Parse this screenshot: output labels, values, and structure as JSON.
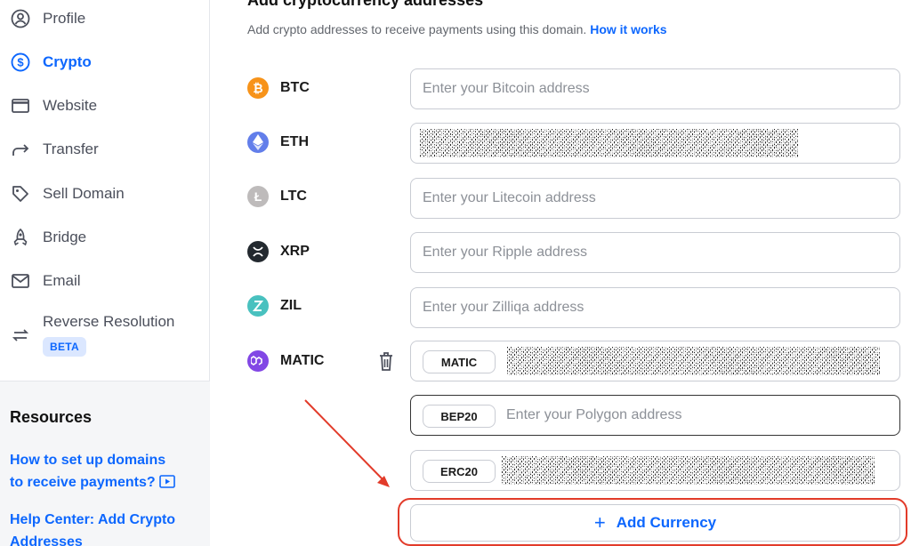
{
  "sidebar": {
    "items": [
      {
        "label": "Profile",
        "icon": "profile-icon"
      },
      {
        "label": "Crypto",
        "icon": "dollar-circle-icon",
        "active": true
      },
      {
        "label": "Website",
        "icon": "browser-window-icon"
      },
      {
        "label": "Transfer",
        "icon": "forward-arrow-icon"
      },
      {
        "label": "Sell Domain",
        "icon": "tag-icon"
      },
      {
        "label": "Bridge",
        "icon": "rocket-icon"
      },
      {
        "label": "Email",
        "icon": "mail-icon"
      },
      {
        "label": "Reverse Resolution",
        "icon": "swap-arrows-icon",
        "badge": "BETA"
      }
    ],
    "resources": {
      "title": "Resources",
      "links": [
        {
          "line1": "How to set up domains",
          "line2": "to receive payments?"
        },
        {
          "line1": "Help Center: Add Crypto",
          "line2": "Addresses"
        }
      ]
    }
  },
  "main": {
    "heading": "Add cryptocurrency addresses",
    "subtitle": "Add crypto addresses to receive payments using this domain.",
    "how_link": "How it works",
    "currencies": [
      {
        "symbol": "BTC",
        "placeholder": "Enter your Bitcoin address",
        "color": "#f7931a"
      },
      {
        "symbol": "ETH",
        "placeholder": "",
        "color": "#627eea"
      },
      {
        "symbol": "LTC",
        "placeholder": "Enter your Litecoin address",
        "color": "#bebbbb"
      },
      {
        "symbol": "XRP",
        "placeholder": "Enter your Ripple address",
        "color": "#23292f"
      },
      {
        "symbol": "ZIL",
        "placeholder": "Enter your Zilliqa address",
        "color": "#49c1bf"
      },
      {
        "symbol": "MATIC",
        "placeholder": "",
        "color": "#8247e5"
      }
    ],
    "matic_networks": [
      {
        "tag": "MATIC",
        "placeholder": ""
      },
      {
        "tag": "BEP20",
        "placeholder": "Enter your Polygon address"
      },
      {
        "tag": "ERC20",
        "placeholder": ""
      }
    ],
    "add_button": "Add Currency"
  },
  "colors": {
    "accent": "#0d67fe",
    "annotation": "#e23b2a"
  }
}
